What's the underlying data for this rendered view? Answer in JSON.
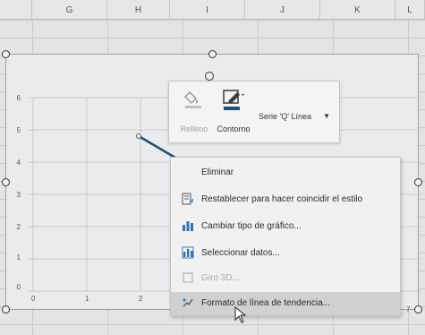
{
  "sheet": {
    "columns": [
      "G",
      "H",
      "I",
      "J",
      "K",
      "L"
    ]
  },
  "chart": {
    "y_ticks": [
      "6",
      "5",
      "4",
      "3",
      "2",
      "1",
      "0"
    ],
    "x_ticks": [
      "0",
      "1",
      "2"
    ],
    "right_tick": "7"
  },
  "mini_toolbar": {
    "fill_label": "Relleno",
    "outline_label": "Contorno",
    "series_select": "Serie 'Q' Línea"
  },
  "context_menu": {
    "items": [
      {
        "label": "Eliminar",
        "icon": "none",
        "disabled": false
      },
      {
        "label": "Restablecer para hacer coincidir el estilo",
        "icon": "reset-style-icon",
        "disabled": false
      },
      {
        "label": "Cambiar tipo de gráfico...",
        "icon": "chart-type-icon",
        "disabled": false
      },
      {
        "label": "Seleccionar datos...",
        "icon": "select-data-icon",
        "disabled": false
      },
      {
        "label": "Giro 3D...",
        "icon": "rotation-3d-icon",
        "disabled": true
      },
      {
        "label": "Formato de línea de tendencia...",
        "icon": "format-trendline-icon",
        "disabled": false
      }
    ]
  }
}
